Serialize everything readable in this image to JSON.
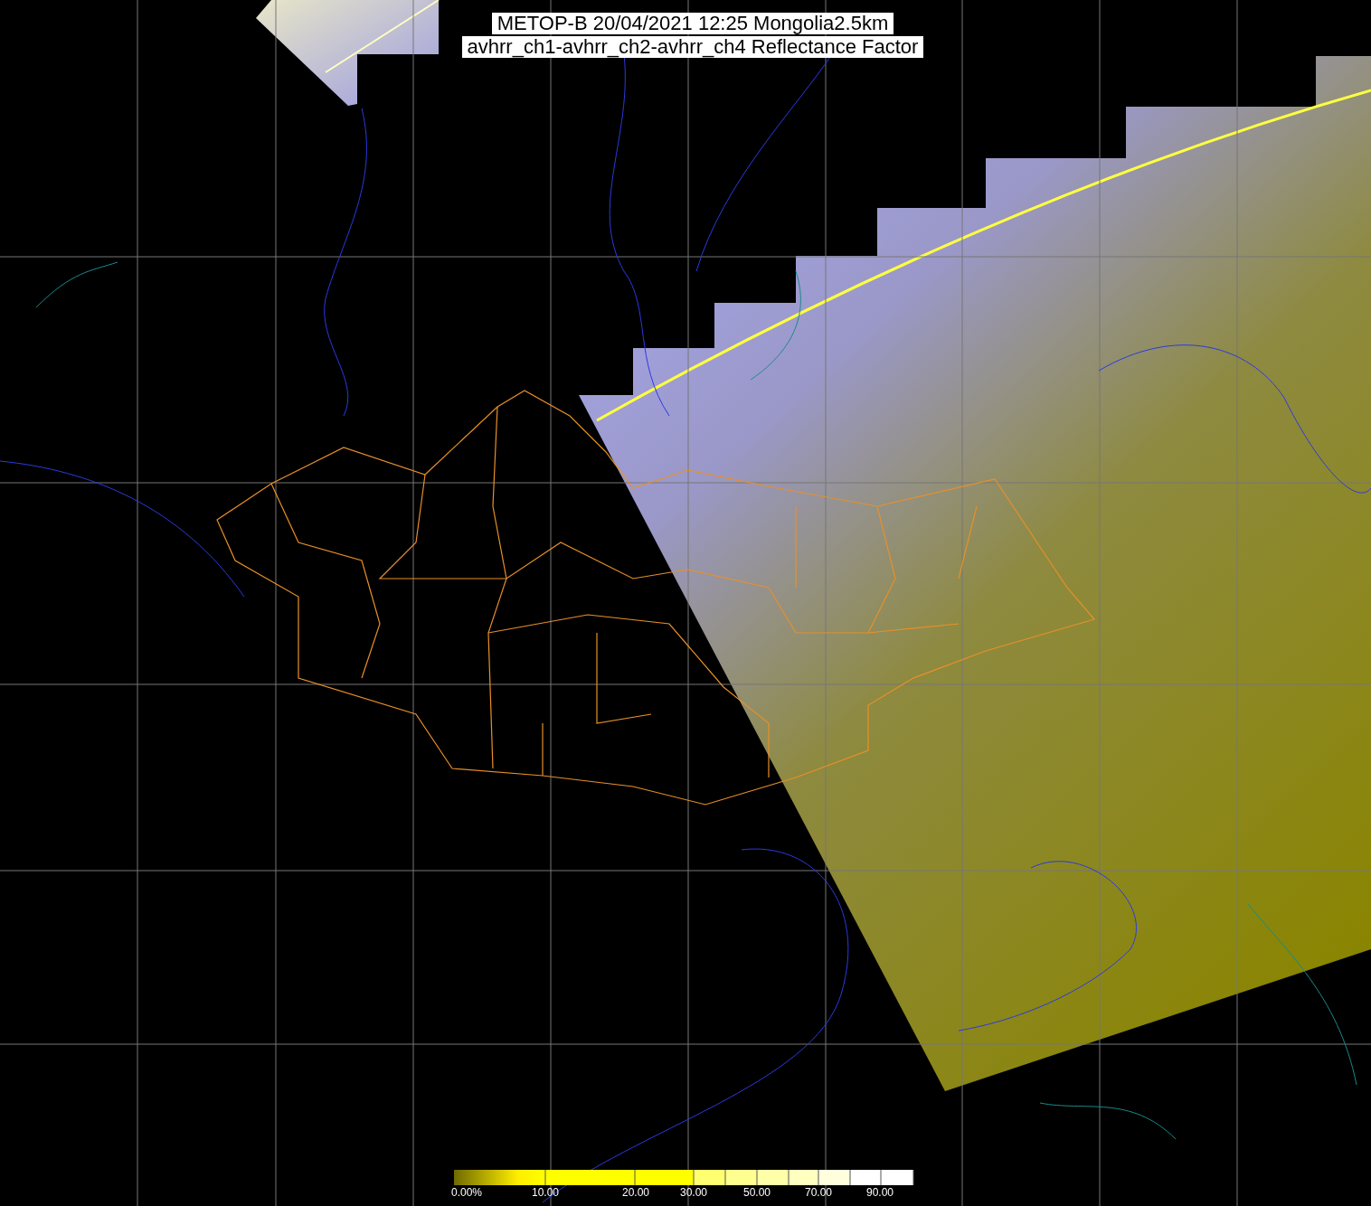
{
  "title": {
    "lines": [
      "METOP-B 20/04/2021 12:25 Mongolia2.5km",
      "avhrr_ch1-avhrr_ch2-avhrr_ch4 Reflectance Factor"
    ]
  },
  "legend": {
    "labels": [
      "0.00%",
      "10.00",
      "20.00",
      "30.00",
      "50.00",
      "70.00",
      "90.00"
    ]
  }
}
